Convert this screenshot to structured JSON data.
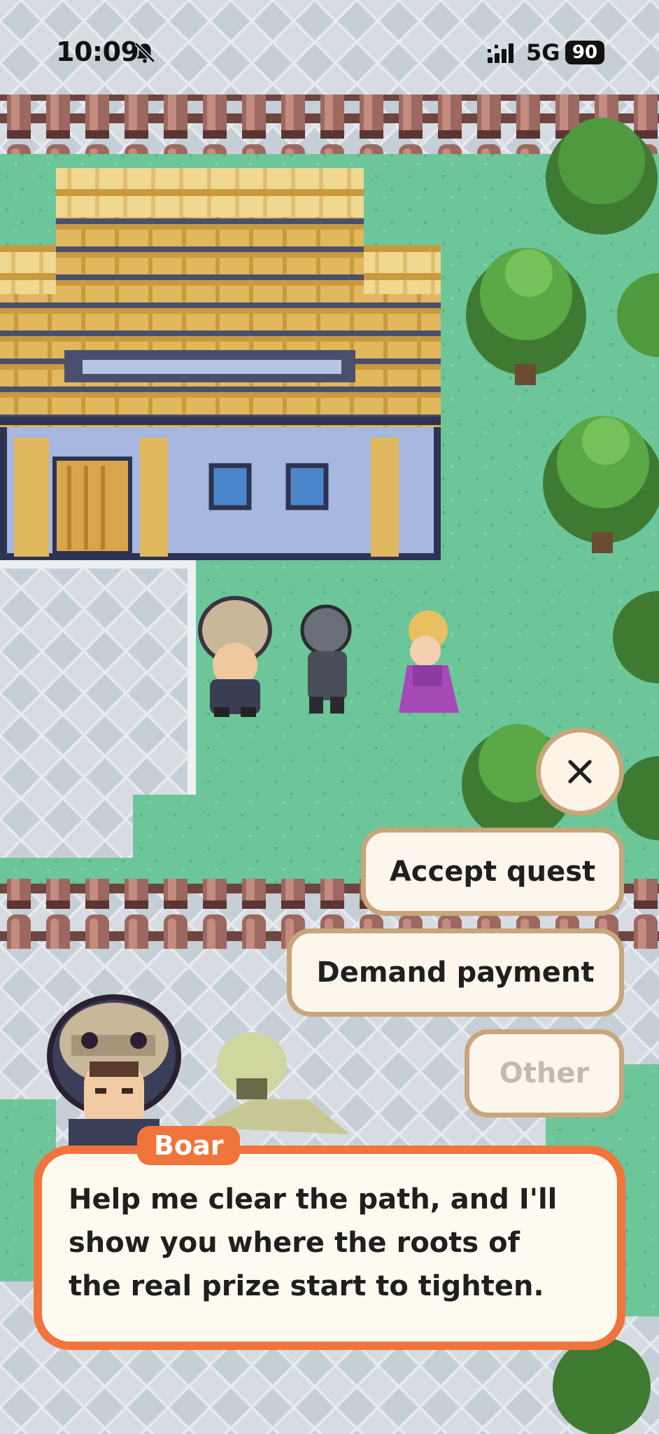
{
  "status_bar": {
    "time": "10:09",
    "network": "5G",
    "battery": "90",
    "icons": [
      "bell-slash-icon",
      "cellular-signal-icon"
    ]
  },
  "dialog": {
    "speaker": "Boar",
    "text": "Help me clear the path, and I'll show you where the roots of the real prize start to tighten."
  },
  "choices": {
    "accept": "Accept quest",
    "demand": "Demand payment",
    "other": "Other"
  },
  "colors": {
    "grass": "#6cc69a",
    "paving": "#d4dae0",
    "roof": "#e2b85e",
    "fence": "#8a5a52",
    "dialog_border": "#f0743c",
    "button_border": "#c8a57a",
    "button_bg": "#fdf6ec"
  }
}
